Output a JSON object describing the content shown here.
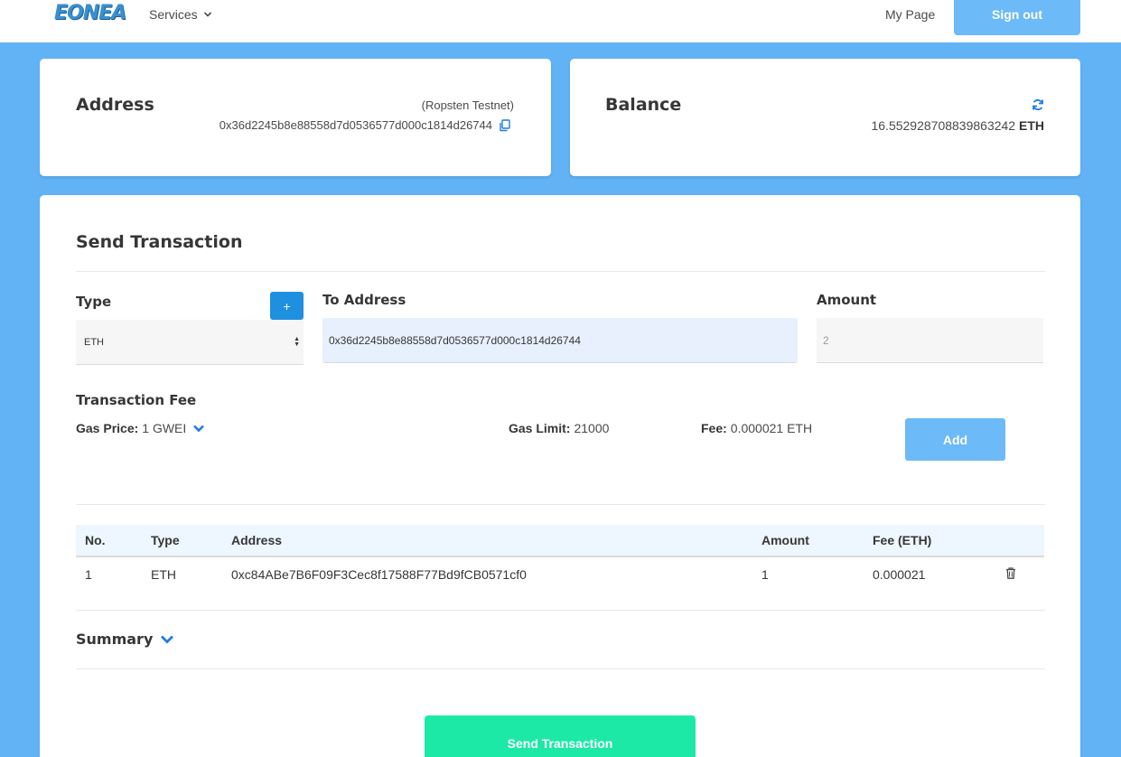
{
  "navbar": {
    "logo_text": "EONEA",
    "services_label": "Services",
    "mypage_label": "My Page",
    "signout_label": "Sign out"
  },
  "address_card": {
    "title": "Address",
    "network": "(Ropsten Testnet)",
    "address": "0x36d2245b8e88558d7d0536577d000c1814d26744"
  },
  "balance_card": {
    "title": "Balance",
    "amount": "16.552928708839863242",
    "unit": "ETH"
  },
  "send_card": {
    "title": "Send Transaction",
    "type_label": "Type",
    "add_type_label": "+",
    "type_value": "ETH",
    "to_label": "To Address",
    "to_value": "0x36d2245b8e88558d7d0536577d000c1814d26744",
    "amount_label": "Amount",
    "amount_placeholder": "2",
    "fee_section_label": "Transaction Fee",
    "gas_price_label": "Gas Price:",
    "gas_price_value": "1 GWEI",
    "gas_limit_label": "Gas Limit:",
    "gas_limit_value": "21000",
    "fee_label": "Fee:",
    "fee_value": "0.000021 ETH",
    "add_button": "Add",
    "table": {
      "headers": [
        "No.",
        "Type",
        "Address",
        "Amount",
        "Fee (ETH)"
      ],
      "rows": [
        {
          "no": "1",
          "type": "ETH",
          "address": "0xc84ABe7B6F09F3Cec8f17588F77Bd9fCB0571cf0",
          "amount": "1",
          "fee": "0.000021"
        }
      ]
    },
    "summary_label": "Summary",
    "send_button": "Send Transaction"
  },
  "colors": {
    "background": "#62b3f5",
    "primary_button": "#6cbaf7",
    "plus_button": "#1f8fdf",
    "send_button": "#1de9a7",
    "link_blue": "#1f7de0"
  },
  "icons": {
    "services_chevron": "chevron-down-icon",
    "copy": "copy-icon",
    "refresh": "refresh-icon",
    "gas_chevron": "chevron-down-icon",
    "delete": "trash-icon",
    "summary_chevron": "chevron-down-icon"
  }
}
